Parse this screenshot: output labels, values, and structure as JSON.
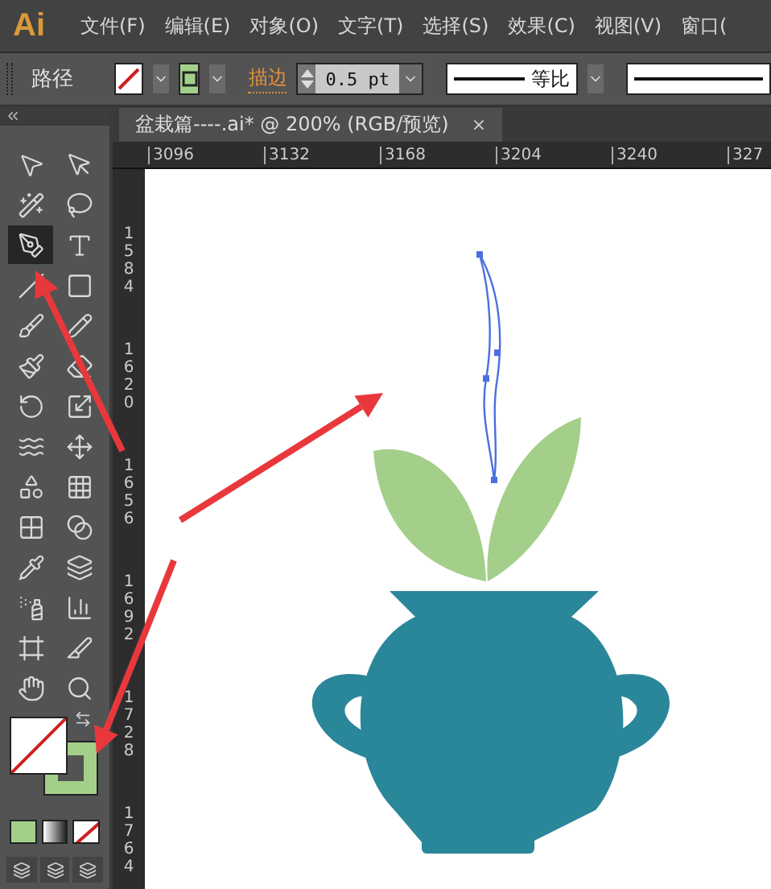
{
  "app": {
    "logo": "Ai"
  },
  "menu": [
    "文件(F)",
    "编辑(E)",
    "对象(O)",
    "文字(T)",
    "选择(S)",
    "效果(C)",
    "视图(V)",
    "窗口("
  ],
  "control_bar": {
    "object_label": "路径",
    "stroke_label": "描边",
    "stroke_weight": "0.5 pt",
    "profile": "等比"
  },
  "document_tab": {
    "title": "盆栽篇----.ai* @ 200% (RGB/预览)",
    "close": "×"
  },
  "rulers": {
    "horizontal": [
      "3096",
      "3132",
      "3168",
      "3204",
      "3240",
      "327"
    ],
    "vertical": [
      "1584",
      "1620",
      "1656",
      "1692",
      "1728",
      "1764"
    ]
  },
  "toolbar": {
    "tools": [
      {
        "selected": false
      },
      {
        "selected": false
      },
      {
        "selected": false
      },
      {
        "selected": false
      },
      {
        "selected": true
      },
      {
        "selected": false
      },
      {
        "selected": false
      },
      {
        "selected": false
      },
      {
        "selected": false
      },
      {
        "selected": false
      },
      {
        "selected": false
      },
      {
        "selected": false
      },
      {
        "selected": false
      },
      {
        "selected": false
      },
      {
        "selected": false
      },
      {
        "selected": false
      },
      {
        "selected": false
      },
      {
        "selected": false
      },
      {
        "selected": false
      },
      {
        "selected": false
      },
      {
        "selected": false
      },
      {
        "selected": false
      },
      {
        "selected": false
      },
      {
        "selected": false
      },
      {
        "selected": false
      },
      {
        "selected": false
      },
      {
        "selected": false
      },
      {
        "selected": false
      }
    ]
  }
}
